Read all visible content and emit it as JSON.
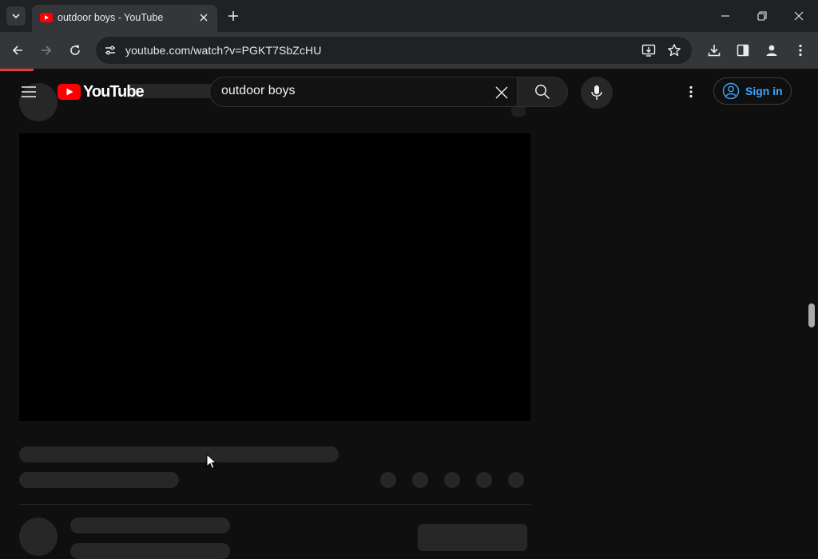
{
  "browser": {
    "tab_title": "outdoor boys - YouTube",
    "url": "youtube.com/watch?v=PGKT7SbZcHU"
  },
  "youtube": {
    "logo_text": "YouTube",
    "search_value": "outdoor boys",
    "sign_in_label": "Sign in"
  },
  "colors": {
    "youtube_red": "#ff0000",
    "link_blue": "#3ea6ff",
    "page_bg": "#0f0f0f",
    "skeleton": "#272727"
  },
  "icons": [
    "tab-list-icon",
    "youtube-favicon",
    "close-icon",
    "plus-icon",
    "minimize-icon",
    "restore-icon",
    "close-window-icon",
    "back-icon",
    "forward-icon",
    "reload-icon",
    "site-info-icon",
    "install-app-icon",
    "star-icon",
    "download-icon",
    "side-panel-icon",
    "profile-icon",
    "kebab-menu-icon",
    "hamburger-icon",
    "youtube-logo-icon",
    "clear-icon",
    "search-icon",
    "mic-icon",
    "account-icon",
    "cursor-icon"
  ]
}
